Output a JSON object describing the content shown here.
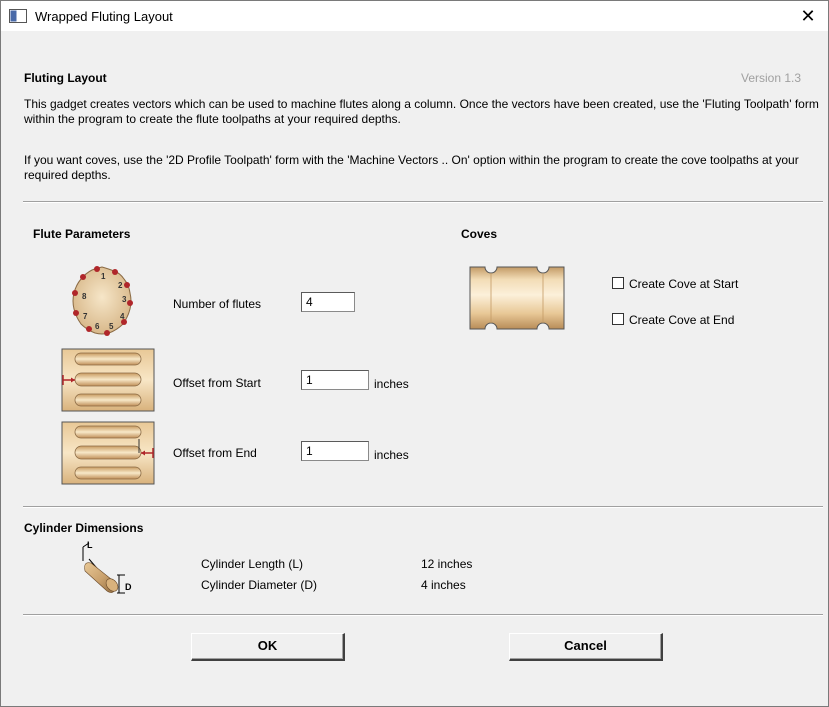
{
  "window": {
    "title": "Wrapped Fluting Layout",
    "close_glyph": "✕"
  },
  "header": {
    "title": "Fluting Layout",
    "version": "Version 1.3",
    "description_1": "This gadget creates vectors which can be used to machine flutes along a column. Once the vectors have been created, use the 'Fluting Toolpath' form within the program to create the flute toolpaths at your required depths.",
    "description_2": "If you want coves, use the '2D Profile Toolpath' form with the 'Machine Vectors .. On' option within the program to create the cove toolpaths at your required depths."
  },
  "flute_parameters": {
    "heading": "Flute Parameters",
    "number_of_flutes": {
      "label": "Number of flutes",
      "value": "4"
    },
    "offset_from_start": {
      "label": "Offset from Start",
      "value": "1",
      "unit": "inches"
    },
    "offset_from_end": {
      "label": "Offset from End",
      "value": "1",
      "unit": "inches"
    },
    "diagram_numbers": [
      "1",
      "2",
      "3",
      "4",
      "5",
      "6",
      "7",
      "8"
    ]
  },
  "coves": {
    "heading": "Coves",
    "create_at_start": {
      "label": "Create Cove at Start",
      "checked": false
    },
    "create_at_end": {
      "label": "Create Cove at End",
      "checked": false
    }
  },
  "cylinder": {
    "heading": "Cylinder Dimensions",
    "length_label": "Cylinder Length (L)",
    "length_value": "12  inches",
    "diameter_label": "Cylinder Diameter (D)",
    "diameter_value": "4  inches",
    "icon_letter_l": "L",
    "icon_letter_d": "D"
  },
  "buttons": {
    "ok": "OK",
    "cancel": "Cancel"
  },
  "colors": {
    "wood_light": "#f1d9b0",
    "wood_dark": "#c49a64",
    "marker_red": "#b0262a"
  }
}
